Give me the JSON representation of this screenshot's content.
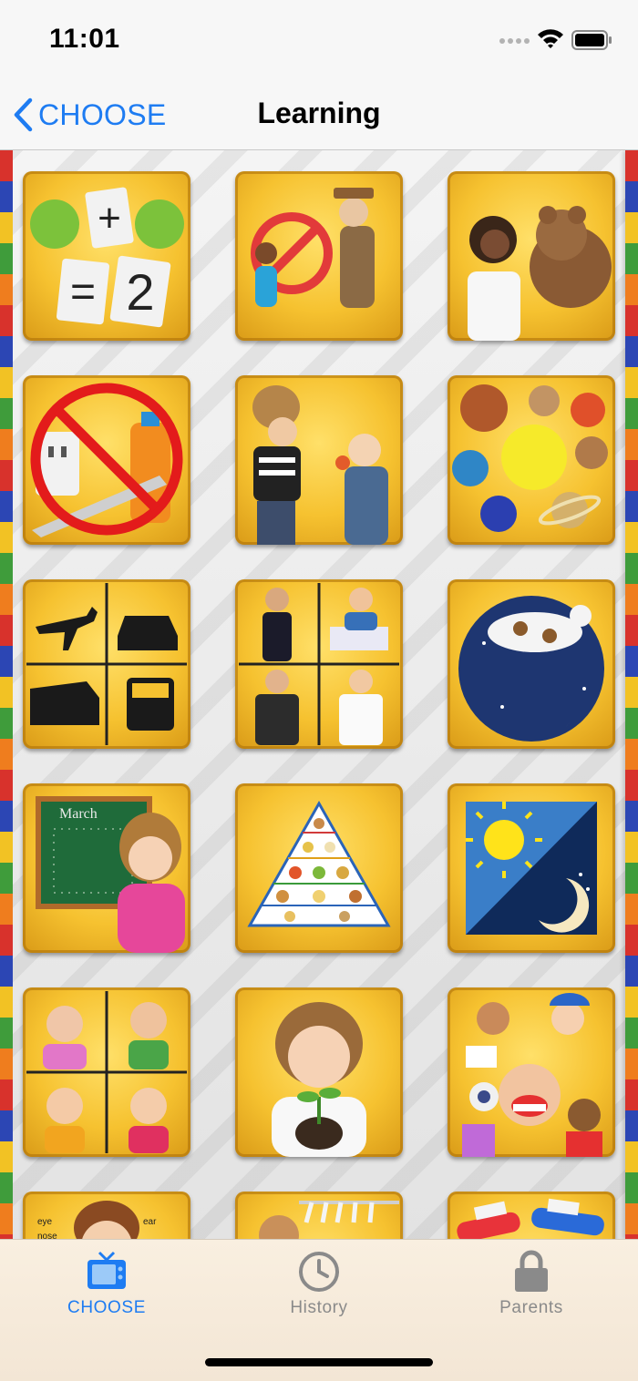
{
  "status_bar": {
    "time": "11:01"
  },
  "nav": {
    "back_label": "CHOOSE",
    "title": "Learning"
  },
  "tiles": [
    {
      "icon": "math-addition-icon"
    },
    {
      "icon": "stranger-danger-icon"
    },
    {
      "icon": "doctor-visit-icon"
    },
    {
      "icon": "household-dangers-icon"
    },
    {
      "icon": "sharing-icon"
    },
    {
      "icon": "solar-system-icon"
    },
    {
      "icon": "transportation-icon"
    },
    {
      "icon": "community-helpers-icon"
    },
    {
      "icon": "nursery-rhyme-icon"
    },
    {
      "icon": "calendar-icon"
    },
    {
      "icon": "food-pyramid-icon"
    },
    {
      "icon": "day-and-night-icon"
    },
    {
      "icon": "emotions-icon"
    },
    {
      "icon": "growing-plants-icon"
    },
    {
      "icon": "five-senses-icon"
    },
    {
      "icon": "body-parts-icon"
    },
    {
      "icon": "getting-dressed-icon"
    },
    {
      "icon": "brushing-teeth-icon"
    }
  ],
  "tab_bar": {
    "choose_label": "CHOOSE",
    "history_label": "History",
    "parents_label": "Parents"
  },
  "colors": {
    "accent": "#1e7cf2",
    "tile_gold": "#f6c230",
    "inactive": "#8a8a8a"
  }
}
